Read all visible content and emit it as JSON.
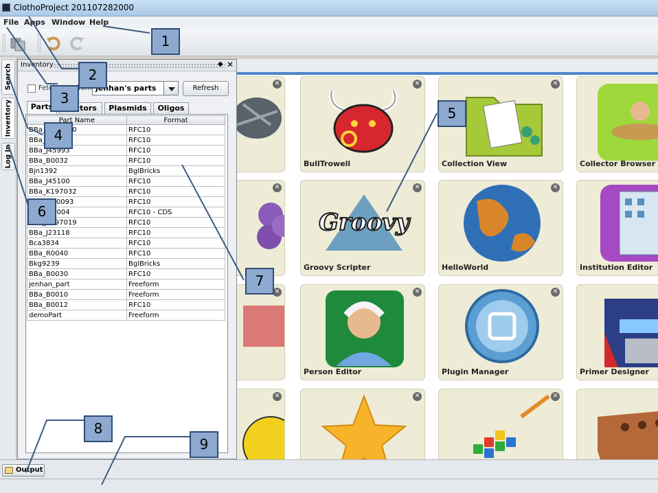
{
  "window": {
    "title": "ClothoProject 201107282000"
  },
  "menu": [
    "File",
    "Apps",
    "Window",
    "Help"
  ],
  "side_tabs": [
    "Search",
    "Inventory",
    "Log In"
  ],
  "inventory": {
    "header": "Inventory",
    "fetch_label": "Fetch only from",
    "combo_value": "jenhan's parts",
    "refresh_label": "Refresh",
    "tabs": [
      "Parts",
      "Vectors",
      "Plasmids",
      "Oligos"
    ],
    "columns": [
      "Part Name",
      "Format"
    ],
    "rows": [
      [
        "BBa_K197000",
        "RFC10"
      ],
      [
        "BBa_J45170",
        "RFC10"
      ],
      [
        "BBa_J45993",
        "RFC10"
      ],
      [
        "BBa_B0032",
        "RFC10"
      ],
      [
        "Bjn1392",
        "BglBricks"
      ],
      [
        "BBa_J45100",
        "RFC10"
      ],
      [
        "BBa_K197032",
        "RFC10"
      ],
      [
        "BBa_M10093",
        "RFC10"
      ],
      [
        "BBa_J45004",
        "RFC10 - CDS"
      ],
      [
        "BBa_K197019",
        "RFC10"
      ],
      [
        "BBa_J23118",
        "RFC10"
      ],
      [
        "Bca3834",
        "RFC10"
      ],
      [
        "BBa_R0040",
        "RFC10"
      ],
      [
        "Bkg9239",
        "BglBricks"
      ],
      [
        "BBa_B0030",
        "RFC10"
      ],
      [
        "jenhan_part",
        "Freeform"
      ],
      [
        "BBa_B0010",
        "Freeform"
      ],
      [
        "BBa_B0012",
        "RFC10"
      ],
      [
        "demoPart",
        "Freeform"
      ]
    ]
  },
  "apps": [
    "BullTrowell",
    "Collection View",
    "Collector Browser",
    "Groovy Scripter",
    "HelloWorld",
    "Institution Editor",
    "Person Editor",
    "Plugin Manager",
    "Primer Designer"
  ],
  "groovy_logo_text": "Groovy",
  "output_label": "Output",
  "callouts": [
    "1",
    "2",
    "3",
    "4",
    "5",
    "6",
    "7",
    "8",
    "9"
  ]
}
